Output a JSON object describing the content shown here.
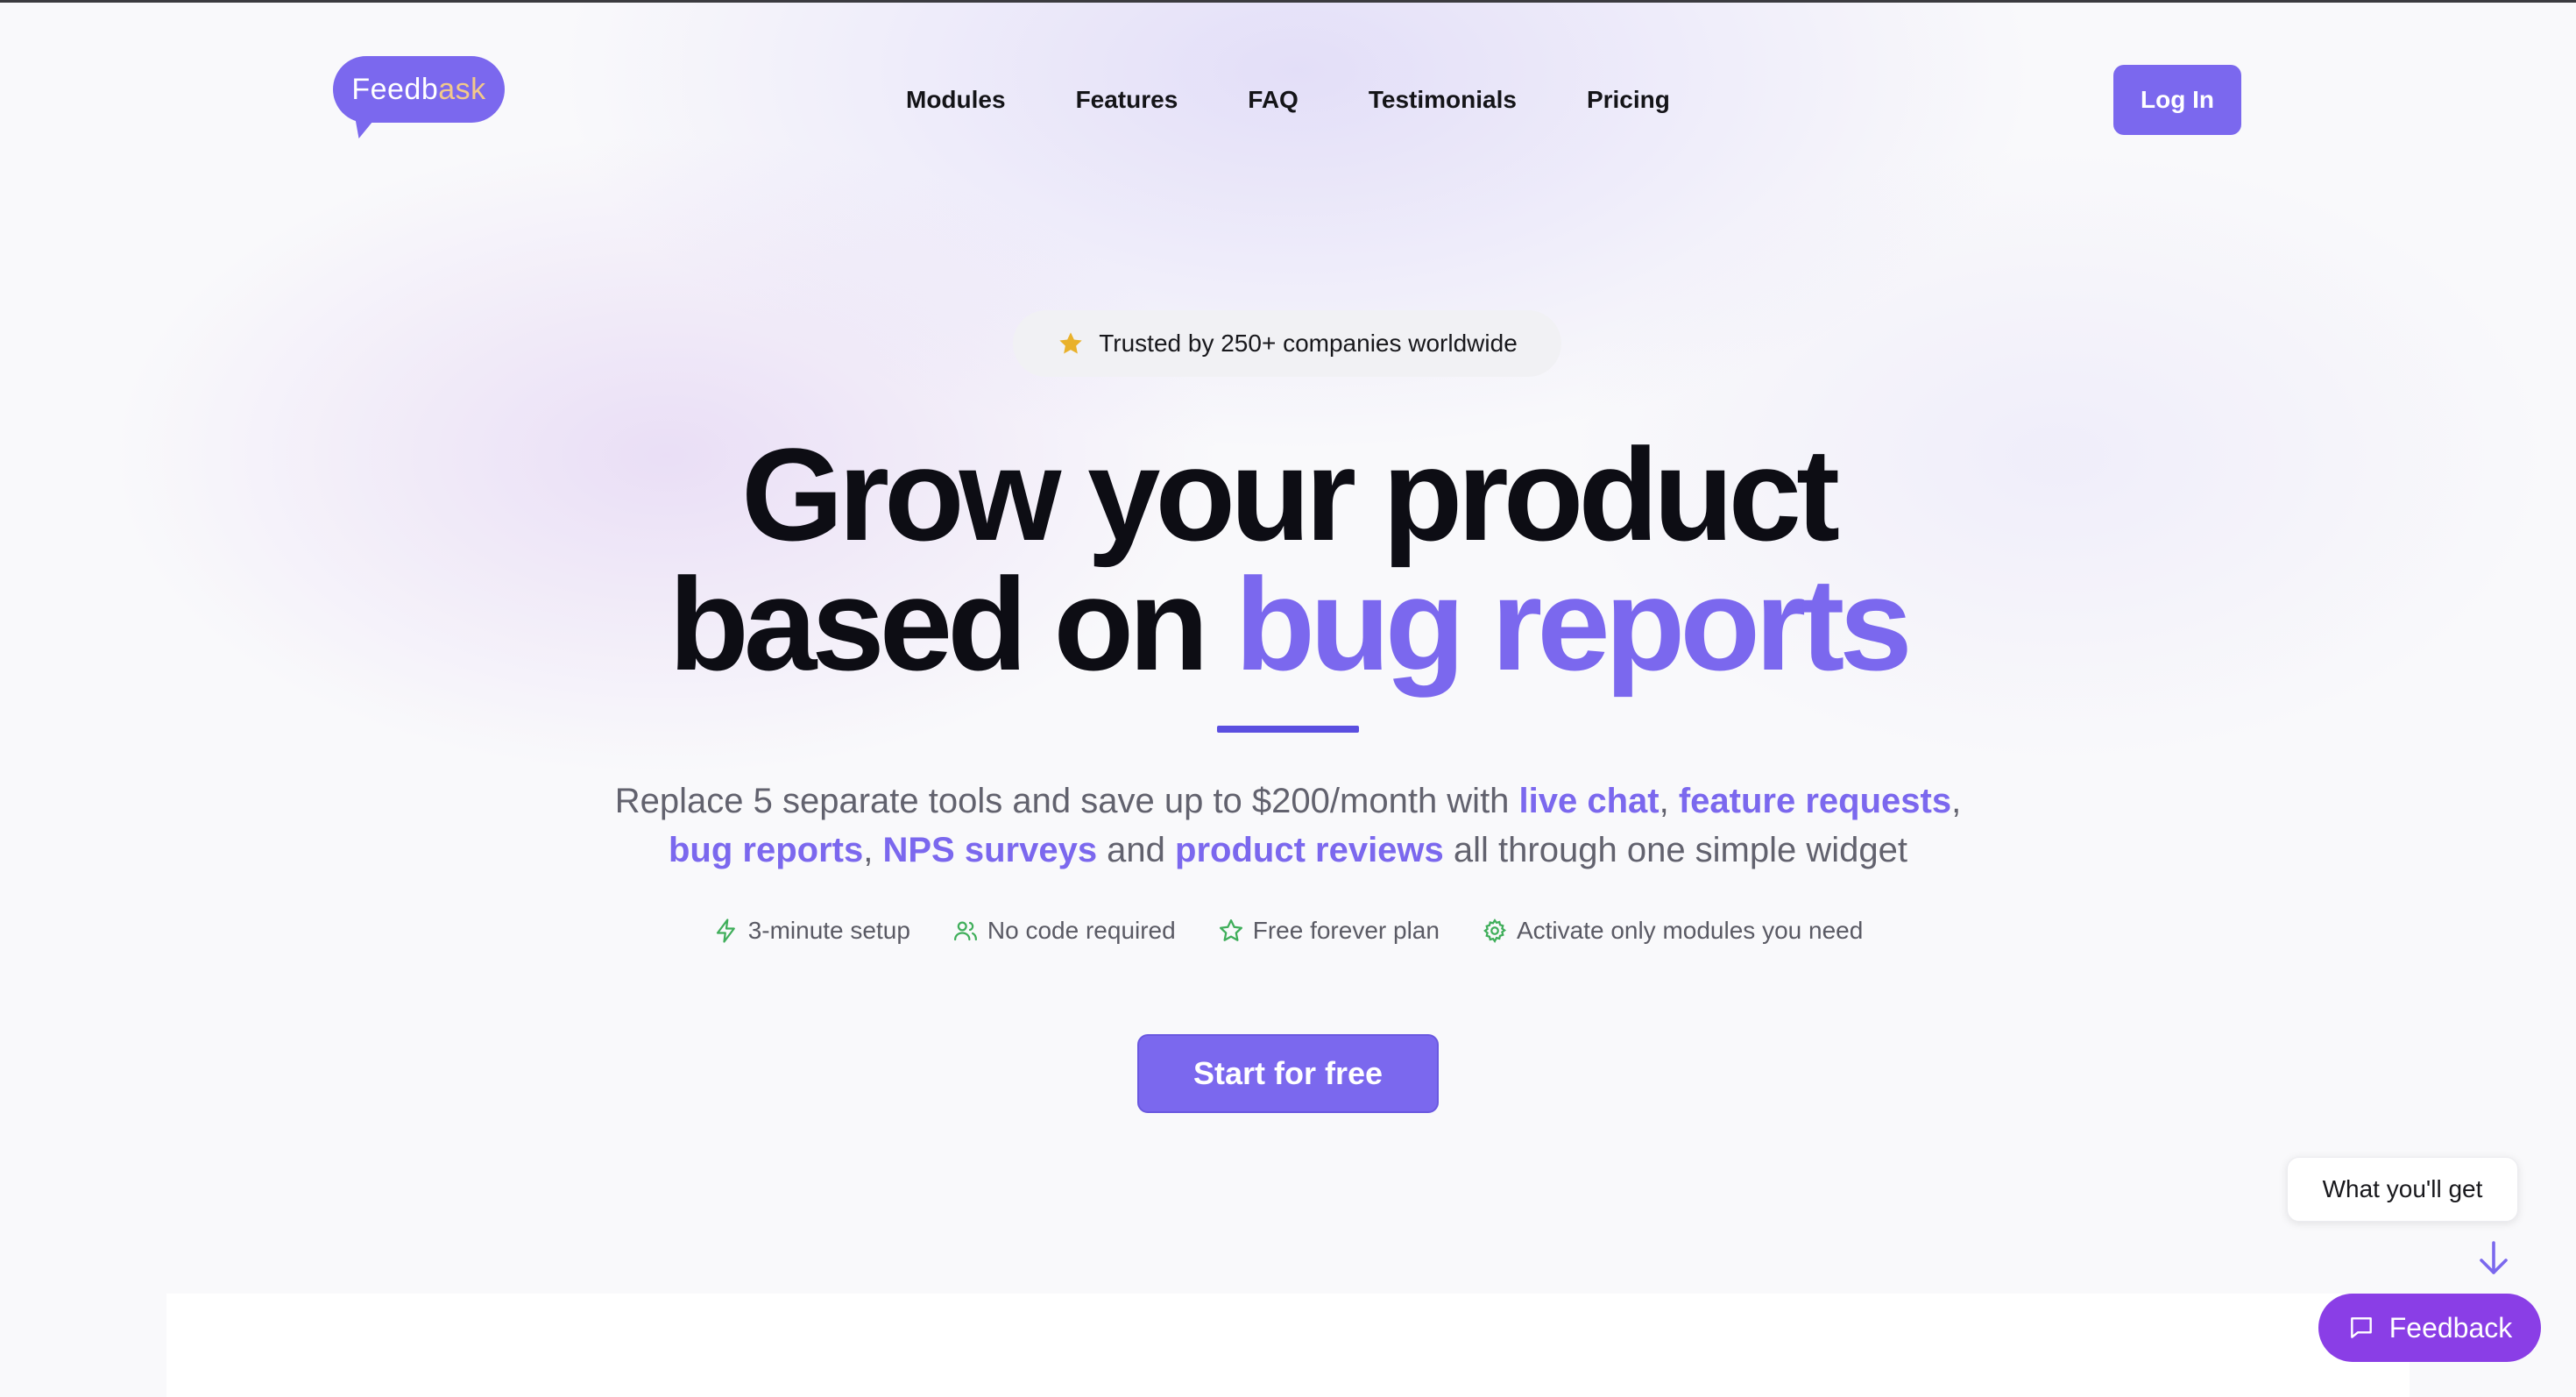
{
  "logo": {
    "part1": "Feedb",
    "part2": "ask"
  },
  "nav": {
    "items": [
      {
        "label": "Modules"
      },
      {
        "label": "Features"
      },
      {
        "label": "FAQ"
      },
      {
        "label": "Testimonials"
      },
      {
        "label": "Pricing"
      }
    ],
    "login_label": "Log In"
  },
  "hero": {
    "badge_text": "Trusted by 250+ companies worldwide",
    "badge_icon": "star-icon",
    "headline_line1": "Grow your product",
    "headline_line2_prefix": "based on ",
    "headline_line2_accent": "bug reports",
    "sub_1": "Replace 5 separate tools and save up to $200/month with ",
    "sub_hl_1": "live chat",
    "sub_sep_1": ", ",
    "sub_hl_2": "feature requests",
    "sub_sep_2": ",",
    "sub_hl_3": "bug reports",
    "sub_sep_3": ", ",
    "sub_hl_4": "NPS surveys",
    "sub_mid": " and ",
    "sub_hl_5": "product reviews",
    "sub_end": " all through one simple widget",
    "bullets": [
      {
        "icon": "lightning-icon",
        "label": "3-minute setup"
      },
      {
        "icon": "users-icon",
        "label": "No code required"
      },
      {
        "icon": "star-outline-icon",
        "label": "Free forever plan"
      },
      {
        "icon": "gear-icon",
        "label": "Activate only modules you need"
      }
    ],
    "cta_label": "Start for free"
  },
  "widget": {
    "tooltip_text": "What you'll get",
    "button_label": "Feedback"
  },
  "colors": {
    "accent": "#7b68ee",
    "feedback_button": "#8a3ee6",
    "bullet_icon": "#3fae5a",
    "badge_star": "#e9b12a"
  }
}
